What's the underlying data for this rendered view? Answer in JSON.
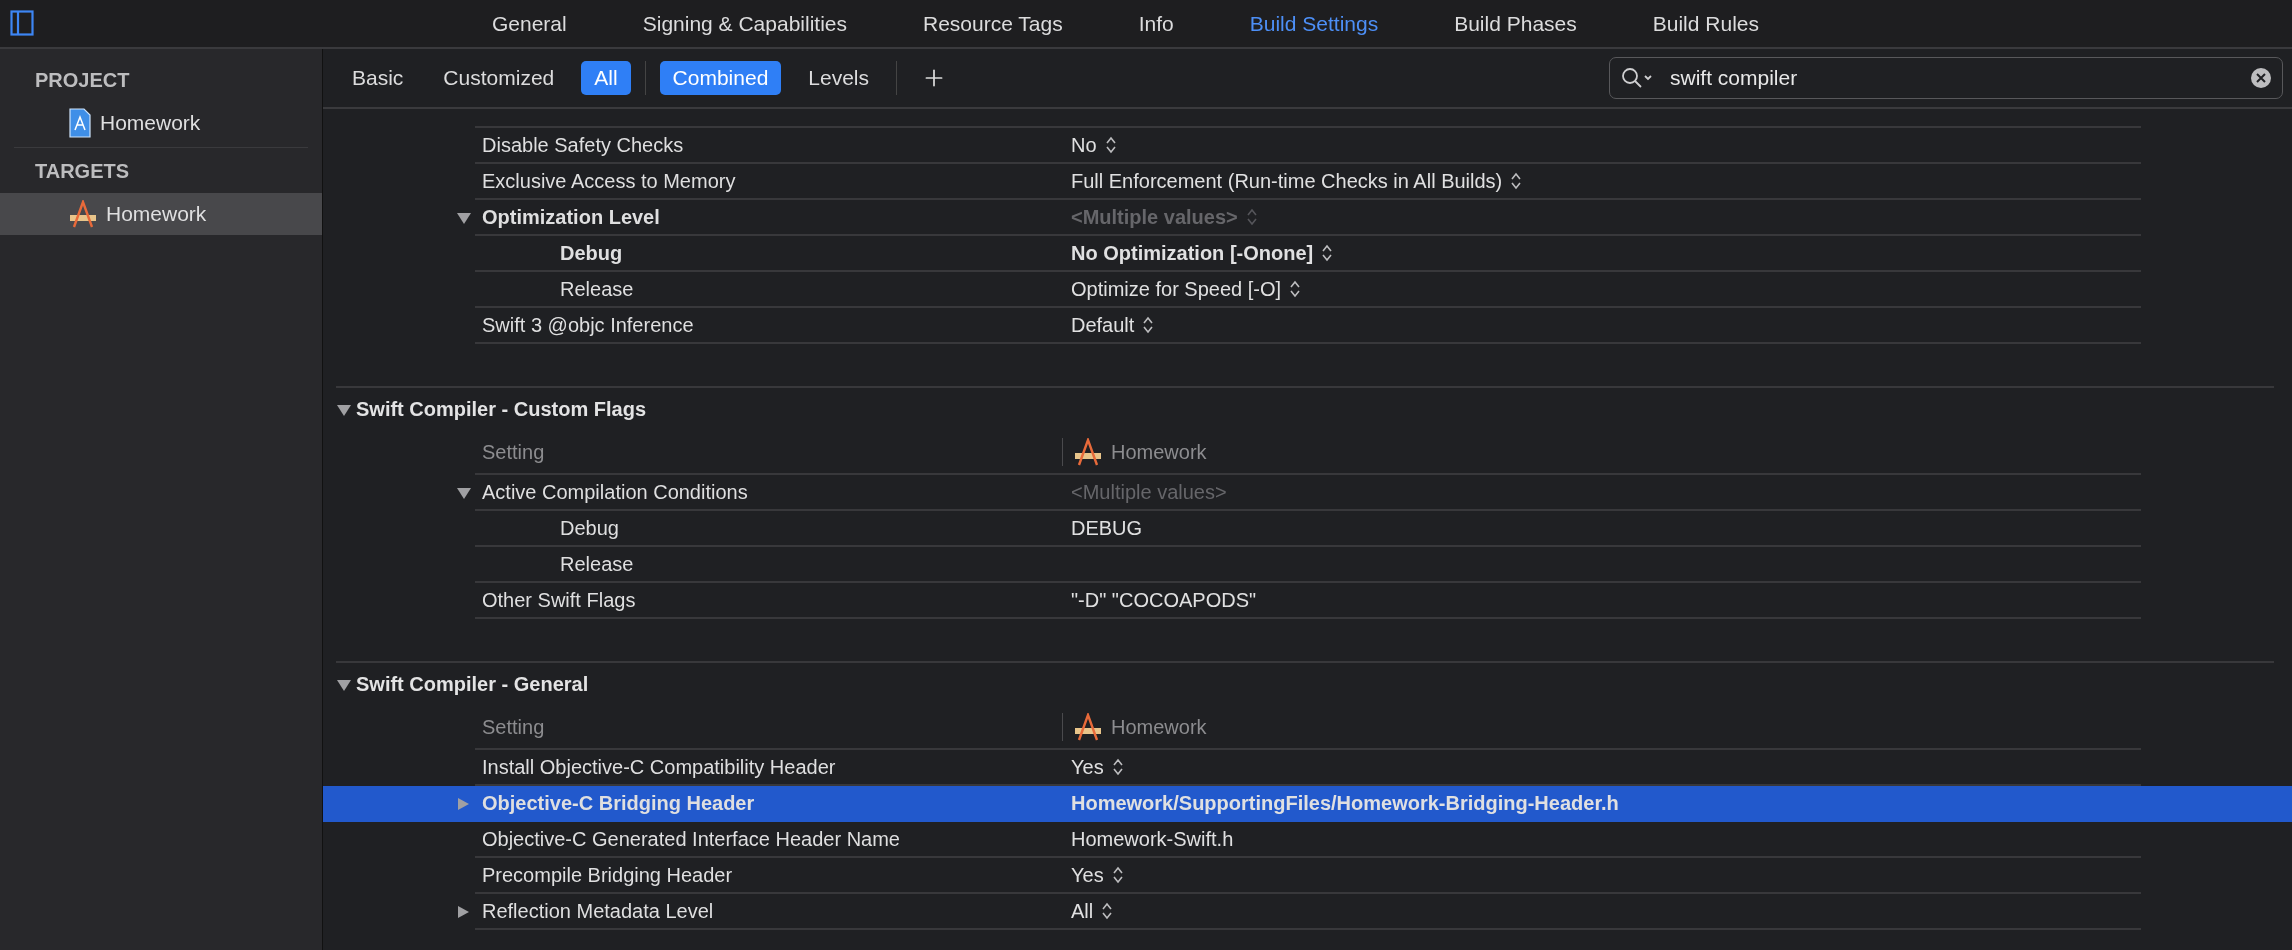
{
  "tabs": [
    {
      "label": "General",
      "selected": false
    },
    {
      "label": "Signing & Capabilities",
      "selected": false
    },
    {
      "label": "Resource Tags",
      "selected": false
    },
    {
      "label": "Info",
      "selected": false
    },
    {
      "label": "Build Settings",
      "selected": true
    },
    {
      "label": "Build Phases",
      "selected": false
    },
    {
      "label": "Build Rules",
      "selected": false
    }
  ],
  "sidebar": {
    "groups": [
      {
        "title": "PROJECT",
        "items": [
          {
            "label": "Homework",
            "kind": "project",
            "selected": false
          }
        ]
      },
      {
        "title": "TARGETS",
        "items": [
          {
            "label": "Homework",
            "kind": "target",
            "selected": true
          }
        ]
      }
    ]
  },
  "filters": [
    {
      "label": "Basic",
      "selected": false
    },
    {
      "label": "Customized",
      "selected": false
    },
    {
      "label": "All",
      "selected": true
    }
  ],
  "views": [
    {
      "label": "Combined",
      "selected": true
    },
    {
      "label": "Levels",
      "selected": false
    }
  ],
  "search": {
    "value": "swift compiler"
  },
  "sections": [
    {
      "rows": [
        {
          "name": "Disable Safety Checks",
          "value": "No",
          "bold": false,
          "dimmed": false,
          "popup": true,
          "selected": false
        },
        {
          "name": "Exclusive Access to Memory",
          "value": "Full Enforcement (Run-time Checks in All Builds)",
          "bold": false,
          "dimmed": false,
          "popup": true,
          "selected": false
        },
        {
          "name": "Optimization Level",
          "value": "<Multiple values>",
          "bold": true,
          "dimmed": true,
          "popup": true,
          "selected": false,
          "expanded": true,
          "children": [
            {
              "name": "Debug",
              "value": "No Optimization [-Onone]",
              "bold": true,
              "dimmed": false,
              "popup": true,
              "selected": false
            },
            {
              "name": "Release",
              "value": "Optimize for Speed [-O]",
              "bold": false,
              "dimmed": false,
              "popup": true,
              "selected": false
            }
          ]
        },
        {
          "name": "Swift 3 @objc Inference",
          "value": "Default",
          "bold": false,
          "dimmed": false,
          "popup": true,
          "selected": false
        }
      ]
    },
    {
      "title": "Swift Compiler - Custom Flags",
      "expanded": true,
      "header": {
        "setting": "Setting",
        "target": "Homework"
      },
      "rows": [
        {
          "name": "Active Compilation Conditions",
          "value": "<Multiple values>",
          "bold": false,
          "dimmed": true,
          "popup": false,
          "selected": false,
          "expanded": true,
          "children": [
            {
              "name": "Debug",
              "value": "DEBUG",
              "bold": false,
              "dimmed": false,
              "popup": false,
              "selected": false
            },
            {
              "name": "Release",
              "bold": false,
              "selected": false
            }
          ]
        },
        {
          "name": "Other Swift Flags",
          "value": "\"-D\" \"COCOAPODS\"",
          "bold": false,
          "dimmed": false,
          "popup": false,
          "selected": false
        }
      ]
    },
    {
      "title": "Swift Compiler - General",
      "expanded": true,
      "header": {
        "setting": "Setting",
        "target": "Homework"
      },
      "rows": [
        {
          "name": "Install Objective-C Compatibility Header",
          "value": "Yes",
          "bold": false,
          "dimmed": false,
          "popup": true,
          "selected": false
        },
        {
          "name": "Objective-C Bridging Header",
          "value": "Homework/SupportingFiles/Homework-Bridging-Header.h",
          "bold": true,
          "dimmed": false,
          "popup": false,
          "selected": true,
          "expanded": false
        },
        {
          "name": "Objective-C Generated Interface Header Name",
          "value": "Homework-Swift.h",
          "bold": false,
          "dimmed": false,
          "popup": false,
          "selected": false
        },
        {
          "name": "Precompile Bridging Header",
          "value": "Yes",
          "bold": false,
          "dimmed": false,
          "popup": true,
          "selected": false
        },
        {
          "name": "Reflection Metadata Level",
          "value": "All",
          "bold": false,
          "dimmed": false,
          "popup": true,
          "selected": false,
          "expanded": false
        }
      ]
    }
  ]
}
